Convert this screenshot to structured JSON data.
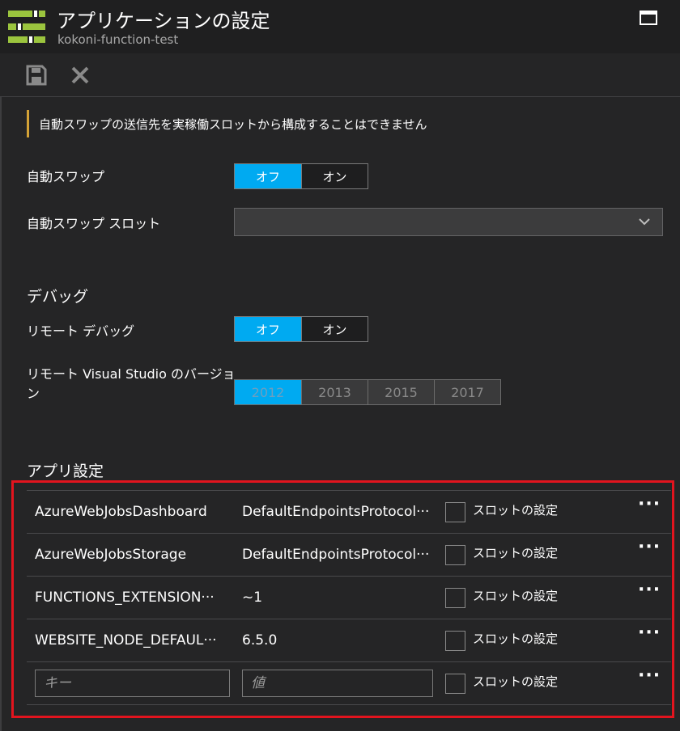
{
  "header": {
    "title": "アプリケーションの設定",
    "subtitle": "kokoni-function-test"
  },
  "toolbar": {
    "save_icon": "save-icon",
    "discard_icon": "close-icon"
  },
  "notice": {
    "text": "自動スワップの送信先を実稼働スロットから構成することはできません",
    "accent_color": "#d4a236"
  },
  "auto_swap": {
    "label": "自動スワップ",
    "off_label": "オフ",
    "on_label": "オン",
    "selected": "オフ"
  },
  "auto_swap_slot": {
    "label": "自動スワップ スロット",
    "value": ""
  },
  "debug": {
    "section_title": "デバッグ",
    "remote_debug_label": "リモート デバッグ",
    "off_label": "オフ",
    "on_label": "オン",
    "selected": "オフ",
    "vs_version_label_line1": "リモート Visual Studio のバージョ",
    "vs_version_label_line2": "ン",
    "versions": [
      "2012",
      "2013",
      "2015",
      "2017"
    ],
    "selected_version": "2012"
  },
  "app_settings": {
    "section_title": "アプリ設定",
    "slot_setting_label": "スロットの設定",
    "more_label": "···",
    "rows": [
      {
        "key": "AzureWebJobsDashboard",
        "value": "DefaultEndpointsProtocol···"
      },
      {
        "key": "AzureWebJobsStorage",
        "value": "DefaultEndpointsProtocol···"
      },
      {
        "key": "FUNCTIONS_EXTENSION···",
        "value": "~1"
      },
      {
        "key": "WEBSITE_NODE_DEFAUL···",
        "value": "6.5.0"
      }
    ],
    "new_row": {
      "key_placeholder": "キー",
      "value_placeholder": "値"
    }
  },
  "colors": {
    "accent": "#00aaf1",
    "highlight_border": "#e2141e",
    "icon_green": "#9bc43e"
  }
}
